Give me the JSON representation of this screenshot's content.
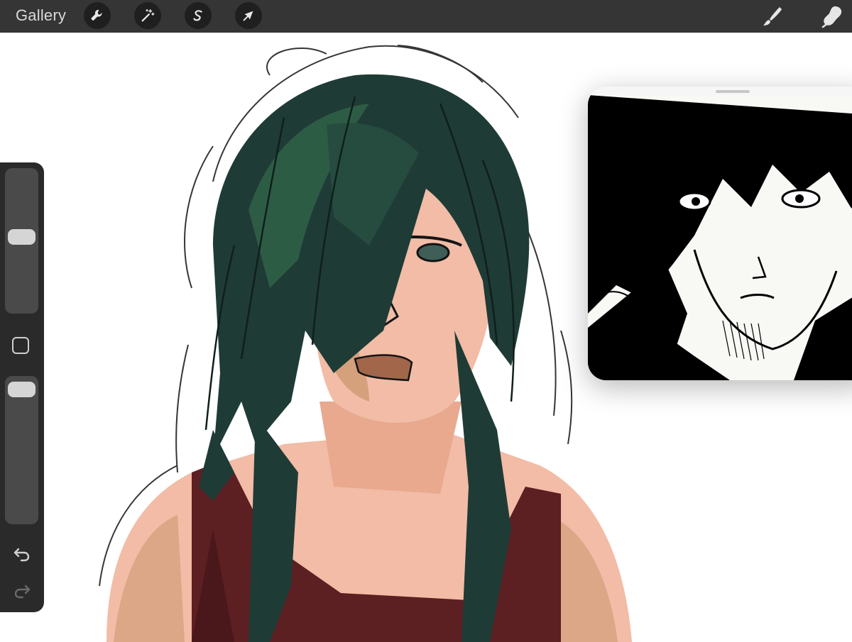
{
  "app": {
    "accent": "#353535"
  },
  "toolbar": {
    "gallery_label": "Gallery",
    "left_tools": [
      {
        "name": "actions",
        "icon": "wrench-icon"
      },
      {
        "name": "adjustments",
        "icon": "magic-wand-icon"
      },
      {
        "name": "selection",
        "icon": "selection-s-icon"
      },
      {
        "name": "transform",
        "icon": "arrow-cursor-icon"
      }
    ],
    "right_tools": [
      {
        "name": "brush",
        "icon": "brush-icon"
      },
      {
        "name": "smudge",
        "icon": "smudge-icon"
      }
    ]
  },
  "sidebar": {
    "brush_size_level": 0.43,
    "opacity_level": 0.94,
    "modifier_icon": "square-modifier-icon",
    "undo_icon": "undo-icon",
    "redo_icon": "redo-icon"
  },
  "canvas": {
    "colors": {
      "hair": "#1f3b36",
      "hair_highlight": "#2d5c45",
      "skin": "#f2bca6",
      "skin_shadow": "#c8966b",
      "top": "#5c1f22",
      "line": "#141414"
    }
  },
  "reference_window": {
    "image": "manga-reference-image"
  }
}
